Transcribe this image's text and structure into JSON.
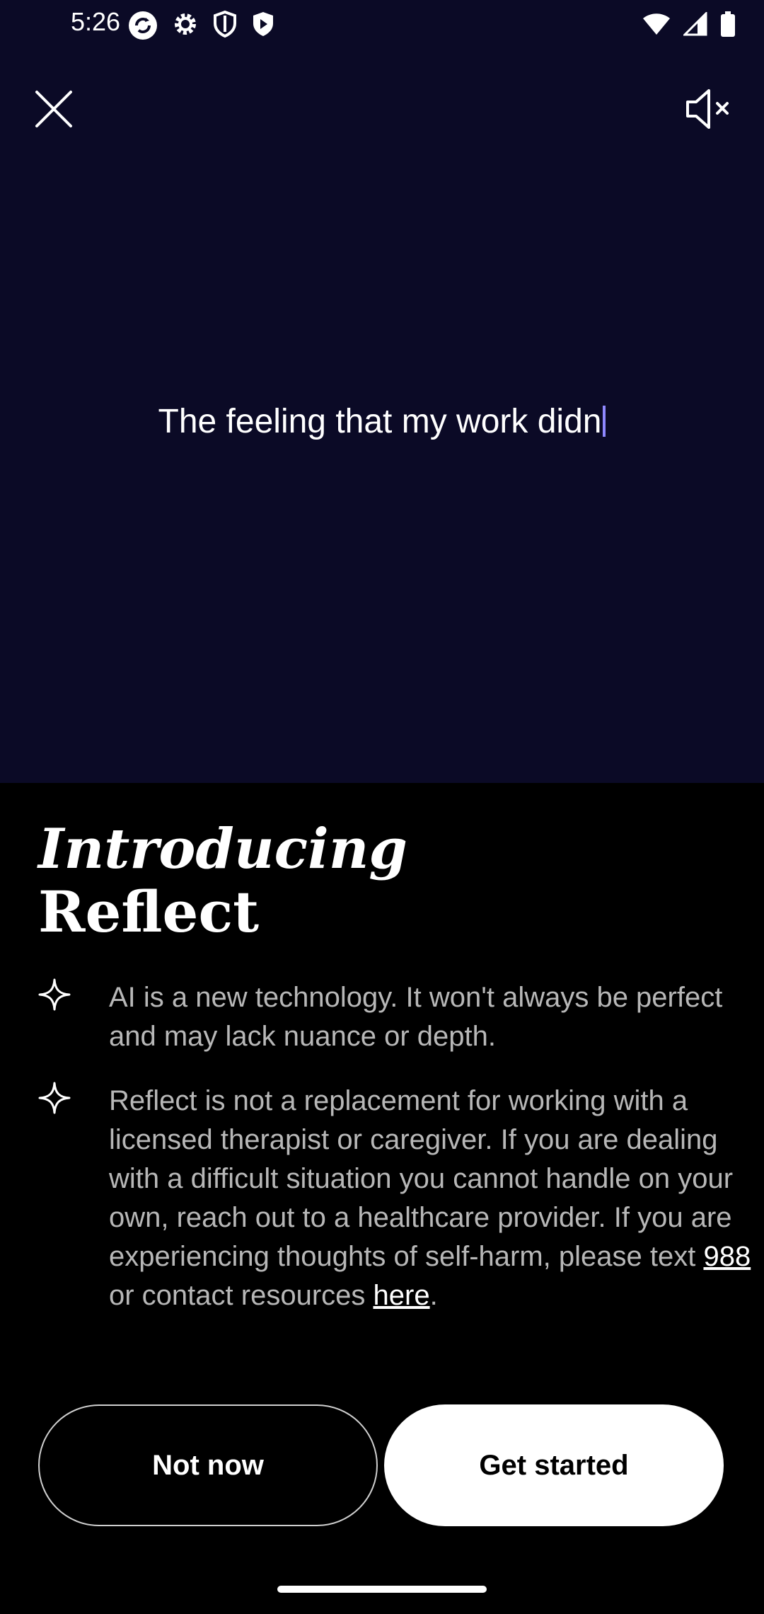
{
  "status_bar": {
    "time": "5:26",
    "left_icons": [
      "sync-icon",
      "settings-icon",
      "shield-icon",
      "play-protect-icon"
    ],
    "right_icons": [
      "wifi-icon",
      "signal-icon",
      "battery-icon"
    ]
  },
  "header": {
    "close_icon": "close-icon",
    "mute_icon": "volume-mute-icon"
  },
  "typing": {
    "text": "The feeling that my work didn"
  },
  "intro": {
    "title_line1": "Introducing",
    "title_line2": "Reflect",
    "items": [
      {
        "icon": "sparkle-icon",
        "text": "AI is a new technology. It won't always be perfect and may lack nuance or depth."
      },
      {
        "icon": "sparkle-icon",
        "text_before": "Reflect is not a replacement for working with a licensed therapist or caregiver. If you are dealing with a difficult situation you cannot handle on your own, reach out to a healthcare provider. If you are experiencing thoughts of self-harm, please text ",
        "link_988": "988",
        "text_middle": " or contact resources ",
        "link_here": "here",
        "text_after": "."
      }
    ]
  },
  "actions": {
    "not_now_label": "Not now",
    "get_started_label": "Get started"
  },
  "colors": {
    "top_background": "#0b0a26",
    "bottom_background": "#000000",
    "cursor": "#8f88ff",
    "body_text": "#b7b7b7"
  }
}
